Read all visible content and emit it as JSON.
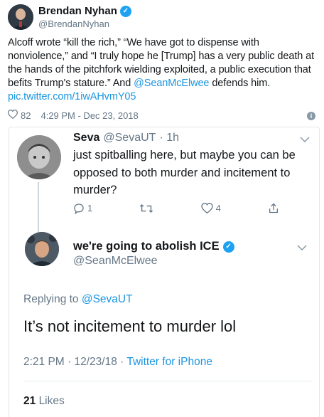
{
  "outer_tweet": {
    "author_name": "Brendan Nyhan",
    "author_handle": "@BrendanNyhan",
    "body_pre": "Alcoff wrote “kill the rich,” “We have got to dispense with nonviolence,” and “I truly hope he [Trump] has a very public death at the hands of the pitchfork wielding exploited, a public execution that befits Trump's stature.” And ",
    "mention": "@SeanMcElwee",
    "body_post": " defends him.",
    "pic_link": "pic.twitter.com/1iwAHvmY05",
    "likes": "82",
    "timestamp": "4:29 PM - Dec 23, 2018"
  },
  "reply_tweet": {
    "author_name": "Seva",
    "author_handle": "@SevaUT",
    "age": "· 1h",
    "text": "just spitballing here, but maybe you can be opposed to both murder and incitement to murder?",
    "reply_count": "1",
    "like_count": "4"
  },
  "main_tweet": {
    "author_name": "we're going to abolish ICE",
    "author_handle": "@SeanMcElwee",
    "replying_label": "Replying to ",
    "replying_to": "@SevaUT",
    "text": "It’s not incitement to murder lol",
    "time_date": "2:21 PM · 12/23/18 · ",
    "client": "Twitter for iPhone",
    "likes_count": "21",
    "likes_label": "Likes"
  },
  "icons": {
    "verified": "verified-badge-icon",
    "heart": "heart-icon",
    "info": "info-icon",
    "chevron": "chevron-down-icon",
    "reply": "reply-icon",
    "retweet": "retweet-icon",
    "share": "share-icon"
  },
  "colors": {
    "link": "#1b95e0",
    "verified": "#1da1f2",
    "muted": "#657786",
    "text": "#14171a"
  }
}
